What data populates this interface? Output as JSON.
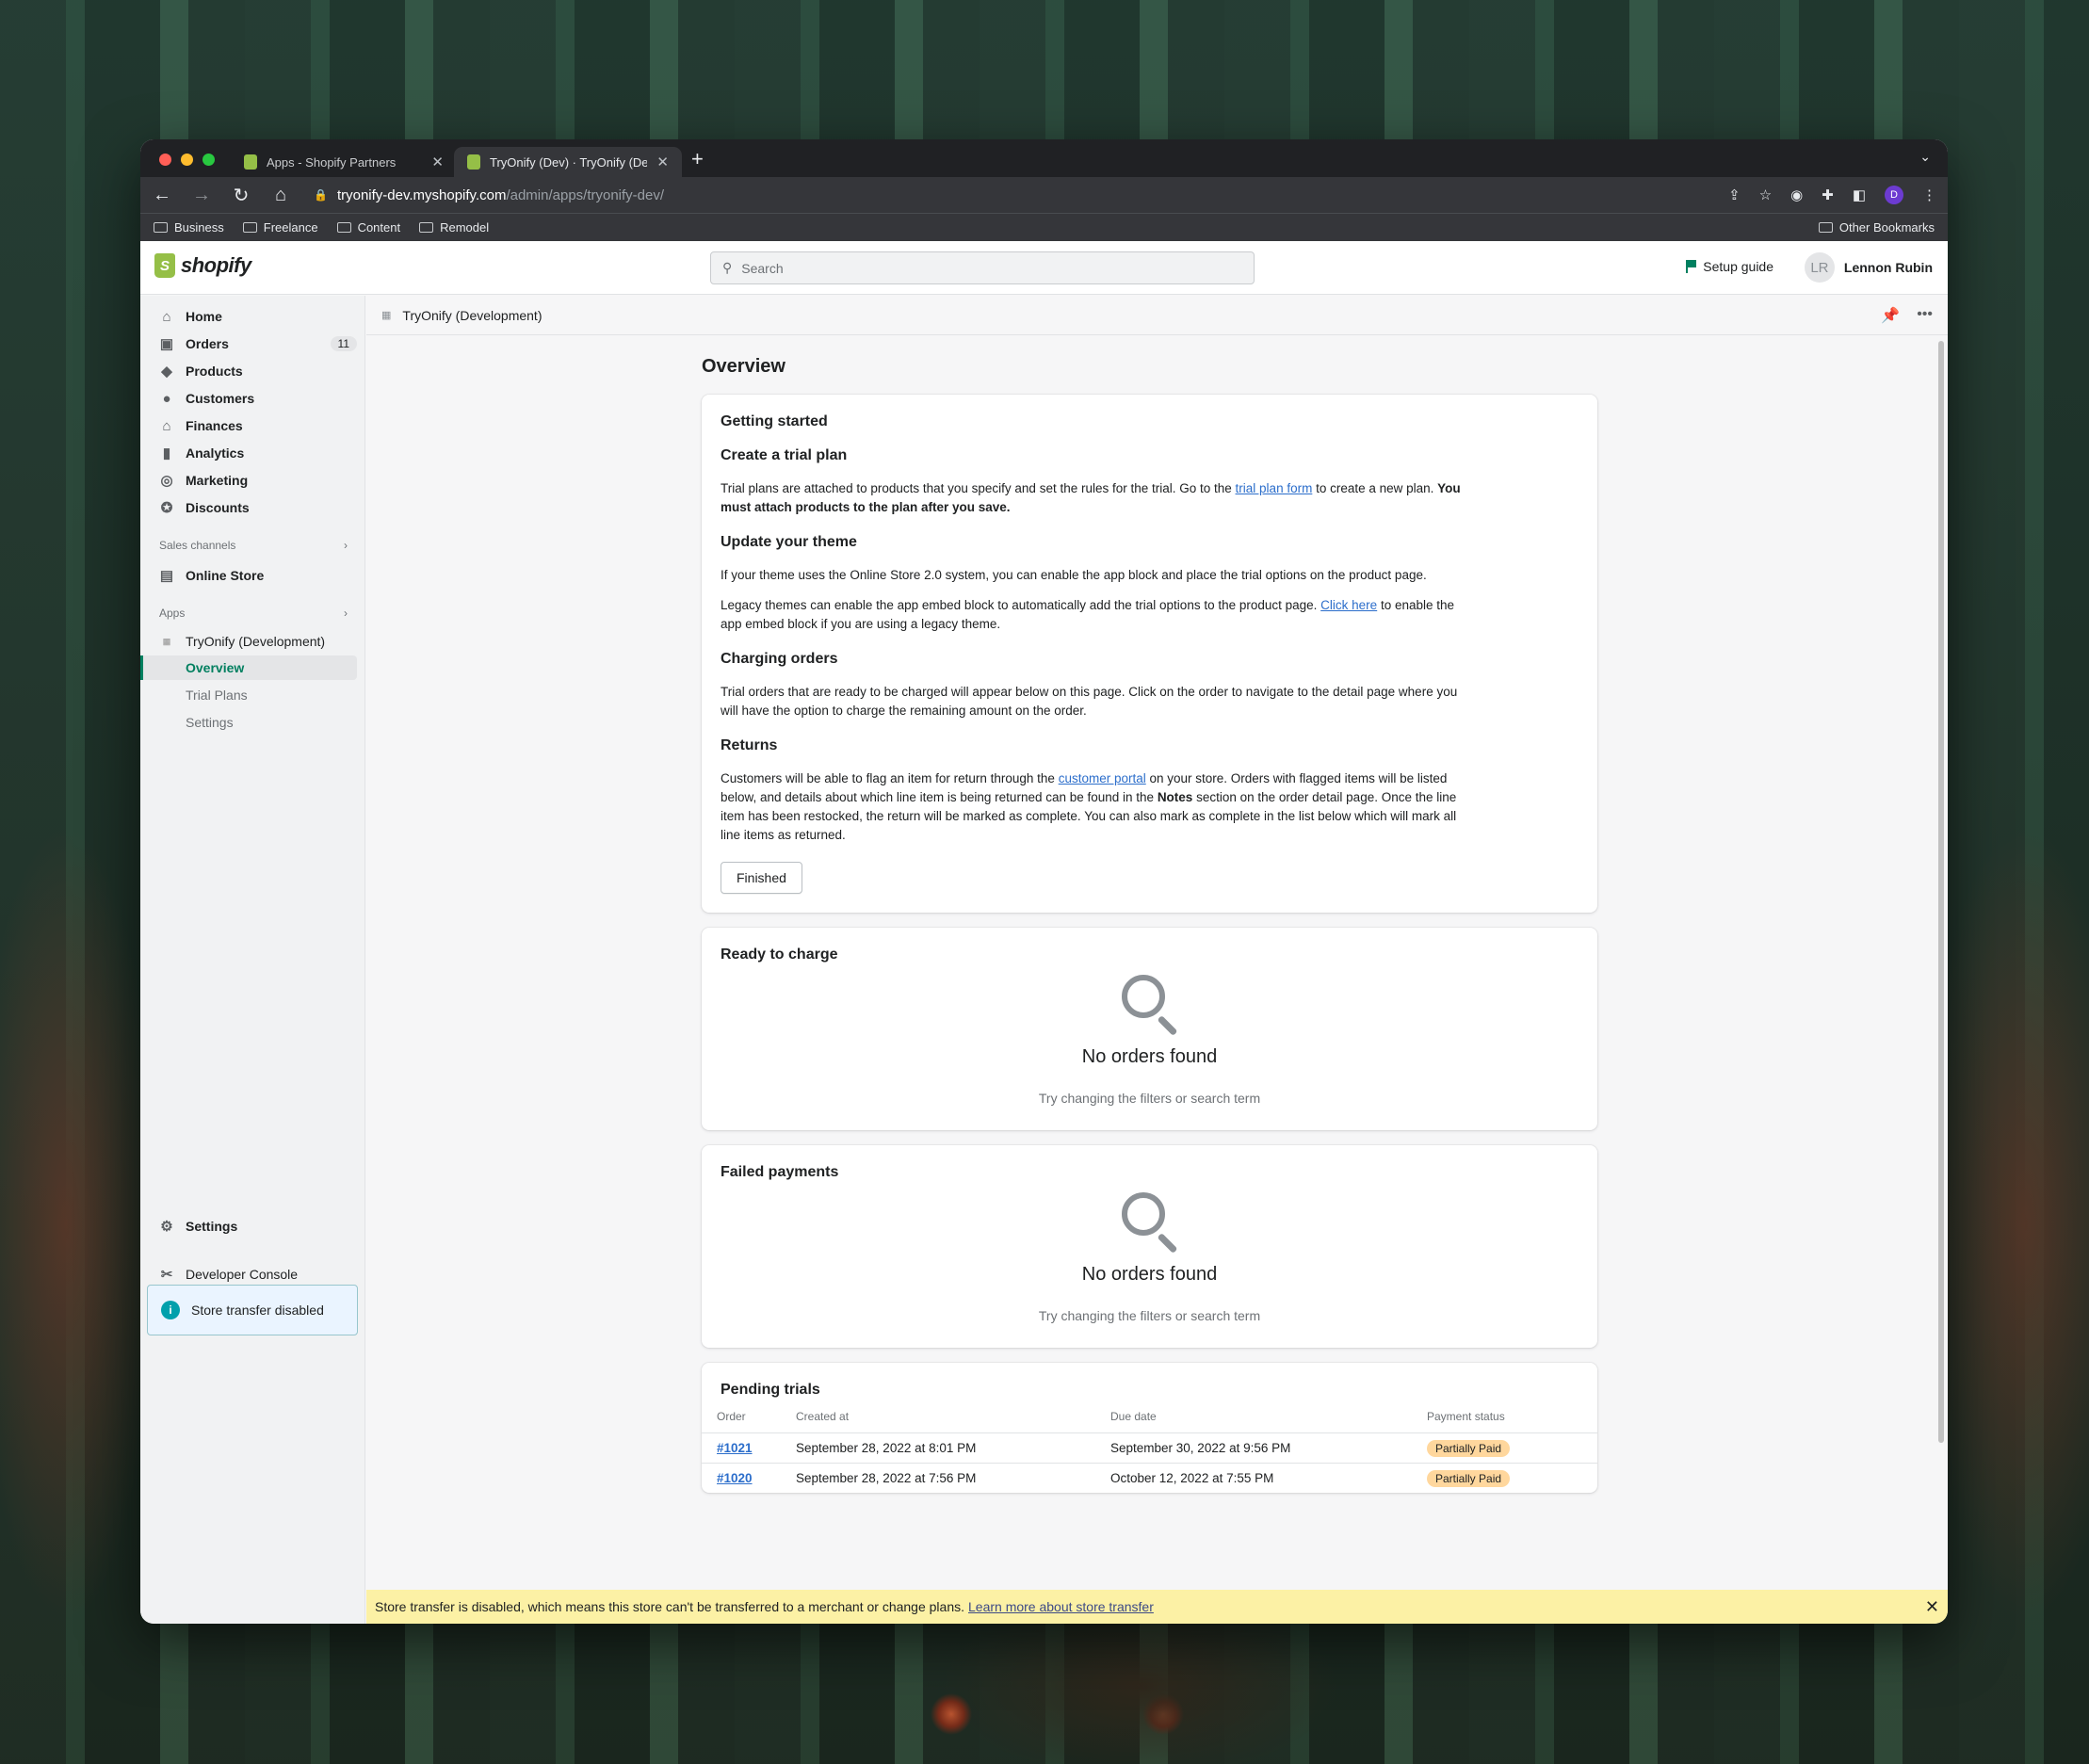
{
  "browser": {
    "tabs": [
      {
        "label": "Apps - Shopify Partners"
      },
      {
        "label": "TryOnify (Dev) · TryOnify (Dev"
      }
    ],
    "url_host": "tryonify-dev.myshopify.com",
    "url_path": "/admin/apps/tryonify-dev/",
    "profile_initial": "D",
    "bookmarks": [
      "Business",
      "Freelance",
      "Content",
      "Remodel"
    ],
    "other_bookmarks": "Other Bookmarks"
  },
  "header": {
    "logo": "shopify",
    "search_placeholder": "Search",
    "setup_guide": "Setup guide",
    "user_initials": "LR",
    "user_name": "Lennon Rubin"
  },
  "sidebar": {
    "items": [
      {
        "label": "Home",
        "icon": "home-icon"
      },
      {
        "label": "Orders",
        "icon": "inbox-icon",
        "badge": "11"
      },
      {
        "label": "Products",
        "icon": "tag-icon"
      },
      {
        "label": "Customers",
        "icon": "person-icon"
      },
      {
        "label": "Finances",
        "icon": "bank-icon"
      },
      {
        "label": "Analytics",
        "icon": "bar-chart-icon"
      },
      {
        "label": "Marketing",
        "icon": "target-icon"
      },
      {
        "label": "Discounts",
        "icon": "discount-icon"
      }
    ],
    "sales_channels": "Sales channels",
    "online_store": "Online Store",
    "apps": "Apps",
    "app_name": "TryOnify (Development)",
    "app_subitems": [
      "Overview",
      "Trial Plans",
      "Settings"
    ],
    "settings": "Settings",
    "developer_console": "Developer Console",
    "store_transfer": "Store transfer disabled"
  },
  "appbar": {
    "title": "TryOnify (Development)"
  },
  "page": {
    "title": "Overview",
    "getting_started": {
      "title": "Getting started",
      "trial_heading": "Create a trial plan",
      "trial_text_1": "Trial plans are attached to products that you specify and set the rules for the trial. Go to the ",
      "trial_link": "trial plan form",
      "trial_text_2": " to create a new plan. ",
      "trial_bold": "You must attach products to the plan after you save.",
      "theme_heading": "Update your theme",
      "theme_text": "If your theme uses the Online Store 2.0 system, you can enable the app block and place the trial options on the product page.",
      "legacy_text_1": "Legacy themes can enable the app embed block to automatically add the trial options to the product page. ",
      "legacy_link": "Click here",
      "legacy_text_2": " to enable the app embed block if you are using a legacy theme.",
      "charging_heading": "Charging orders",
      "charging_text": "Trial orders that are ready to be charged will appear below on this page. Click on the order to navigate to the detail page where you will have the option to charge the remaining amount on the order.",
      "returns_heading": "Returns",
      "returns_text_1": "Customers will be able to flag an item for return through the ",
      "returns_link": "customer portal",
      "returns_text_2": " on your store. Orders with flagged items will be listed below, and details about which line item is being returned can be found in the ",
      "returns_bold": "Notes",
      "returns_text_3": " section on the order detail page. Once the line item has been restocked, the return will be marked as complete. You can also mark as complete in the list below which will mark all line items as returned.",
      "finished_button": "Finished"
    },
    "ready_to_charge": {
      "title": "Ready to charge",
      "empty": "No orders found",
      "hint": "Try changing the filters or search term"
    },
    "failed_payments": {
      "title": "Failed payments",
      "empty": "No orders found",
      "hint": "Try changing the filters or search term"
    },
    "pending_trials": {
      "title": "Pending trials",
      "columns": [
        "Order",
        "Created at",
        "Due date",
        "Payment status"
      ],
      "rows": [
        {
          "order": "#1021",
          "created": "September 28, 2022 at 8:01 PM",
          "due": "September 30, 2022 at 9:56 PM",
          "status": "Partially Paid"
        },
        {
          "order": "#1020",
          "created": "September 28, 2022 at 7:56 PM",
          "due": "October 12, 2022 at 7:55 PM",
          "status": "Partially Paid"
        }
      ]
    }
  },
  "banner": {
    "text": "Store transfer is disabled, which means this store can't be transferred to a merchant or change plans. ",
    "link": "Learn more about store transfer"
  },
  "colors": {
    "accent": "#008060",
    "link": "#2c6ecb",
    "banner": "#fcf1a5",
    "status_pill": "#ffd79d"
  }
}
